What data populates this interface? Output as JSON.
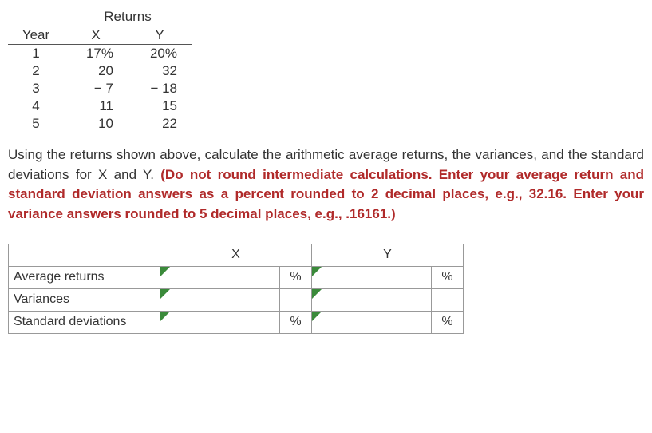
{
  "returns": {
    "super_header": "Returns",
    "headers": {
      "year": "Year",
      "x": "X",
      "y": "Y"
    },
    "rows": [
      {
        "year": "1",
        "x": "17%",
        "y": "20%"
      },
      {
        "year": "2",
        "x": "20",
        "y": "32"
      },
      {
        "year": "3",
        "x": "− 7",
        "y": "− 18"
      },
      {
        "year": "4",
        "x": "11",
        "y": "15"
      },
      {
        "year": "5",
        "x": "10",
        "y": "22"
      }
    ]
  },
  "question": {
    "black": "Using the returns shown above, calculate the arithmetic average returns, the variances, and the standard deviations for X and Y. ",
    "red": "(Do not round intermediate calculations. Enter your average return and standard deviation answers as a percent rounded to 2 decimal places, e.g., 32.16. Enter your variance answers rounded to 5 decimal places, e.g., .16161.)"
  },
  "answers": {
    "col_x": "X",
    "col_y": "Y",
    "rows": {
      "avg": {
        "label": "Average returns",
        "unit": "%"
      },
      "var": {
        "label": "Variances",
        "unit": ""
      },
      "std": {
        "label": "Standard deviations",
        "unit": "%"
      }
    }
  }
}
